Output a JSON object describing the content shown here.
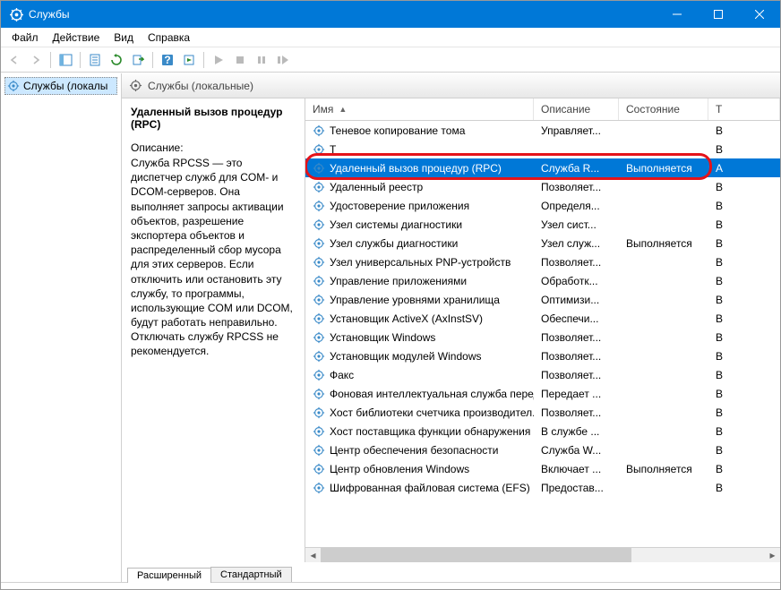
{
  "window": {
    "title": "Службы"
  },
  "menu": {
    "file": "Файл",
    "action": "Действие",
    "view": "Вид",
    "help": "Справка"
  },
  "tree": {
    "root": "Службы (локалы"
  },
  "panel_header": "Службы (локальные)",
  "selected": {
    "name": "Удаленный вызов процедур (RPC)",
    "desc_label": "Описание:",
    "desc_text": "Служба RPCSS — это диспетчер служб для COM- и DCOM-серверов. Она выполняет запросы активации объектов, разрешение экспортера объектов и распределенный сбор мусора для этих серверов. Если отключить или остановить эту службу, то программы, использующие COM или DCOM, будут работать неправильно. Отключать службу RPCSS не рекомендуется."
  },
  "columns": {
    "name": "Имя",
    "desc": "Описание",
    "state": "Состояние",
    "type": "Т"
  },
  "rows": [
    {
      "name": "Теневое копирование тома",
      "desc": "Управляет...",
      "state": "",
      "type": "В"
    },
    {
      "name": "Т",
      "desc": "",
      "state": "",
      "type": "В"
    },
    {
      "name": "Удаленный вызов процедур (RPC)",
      "desc": "Служба R...",
      "state": "Выполняется",
      "type": "А",
      "selected": true
    },
    {
      "name": "Удаленный реестр",
      "desc": "Позволяет...",
      "state": "",
      "type": "В"
    },
    {
      "name": "Удостоверение приложения",
      "desc": "Определя...",
      "state": "",
      "type": "В"
    },
    {
      "name": "Узел системы диагностики",
      "desc": "Узел сист...",
      "state": "",
      "type": "В"
    },
    {
      "name": "Узел службы диагностики",
      "desc": "Узел служ...",
      "state": "Выполняется",
      "type": "В"
    },
    {
      "name": "Узел универсальных PNP-устройств",
      "desc": "Позволяет...",
      "state": "",
      "type": "В"
    },
    {
      "name": "Управление приложениями",
      "desc": "Обработк...",
      "state": "",
      "type": "В"
    },
    {
      "name": "Управление уровнями хранилища",
      "desc": "Оптимизи...",
      "state": "",
      "type": "В"
    },
    {
      "name": "Установщик ActiveX (AxInstSV)",
      "desc": "Обеспечи...",
      "state": "",
      "type": "В"
    },
    {
      "name": "Установщик Windows",
      "desc": "Позволяет...",
      "state": "",
      "type": "В"
    },
    {
      "name": "Установщик модулей Windows",
      "desc": "Позволяет...",
      "state": "",
      "type": "В"
    },
    {
      "name": "Факс",
      "desc": "Позволяет...",
      "state": "",
      "type": "В"
    },
    {
      "name": "Фоновая интеллектуальная служба перед...",
      "desc": "Передает ...",
      "state": "",
      "type": "В"
    },
    {
      "name": "Хост библиотеки счетчика производител...",
      "desc": "Позволяет...",
      "state": "",
      "type": "В"
    },
    {
      "name": "Хост поставщика функции обнаружения",
      "desc": "В службе ...",
      "state": "",
      "type": "В"
    },
    {
      "name": "Центр обеспечения безопасности",
      "desc": "Служба W...",
      "state": "",
      "type": "В"
    },
    {
      "name": "Центр обновления Windows",
      "desc": "Включает ...",
      "state": "Выполняется",
      "type": "В"
    },
    {
      "name": "Шифрованная файловая система (EFS)",
      "desc": "Предостав...",
      "state": "",
      "type": "В"
    }
  ],
  "tabs": {
    "extended": "Расширенный",
    "standard": "Стандартный"
  }
}
